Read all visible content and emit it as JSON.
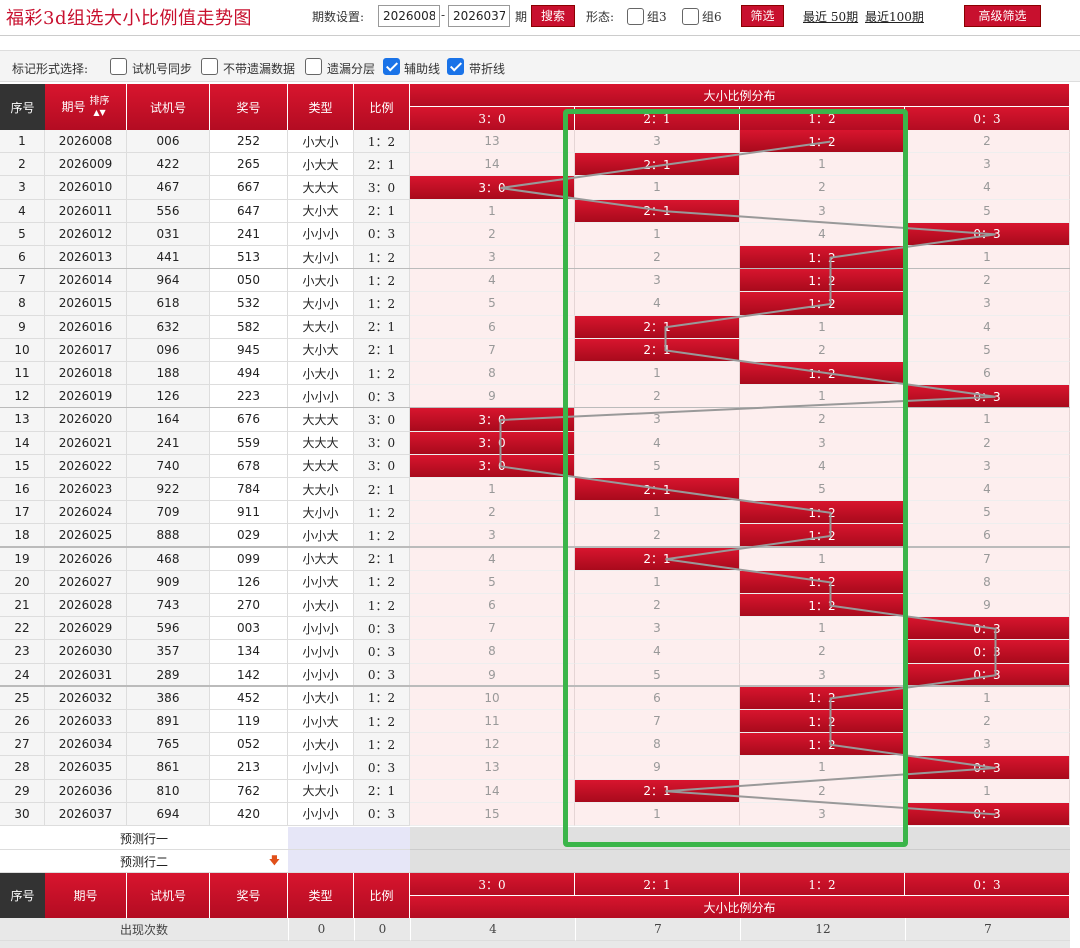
{
  "header": {
    "title": "福彩3d组选大小比例值走势图",
    "period_label": "期数设置:",
    "period_from": "2026008",
    "period_dash": "-",
    "period_to": "2026037",
    "period_unit": "期",
    "search_label": "搜索",
    "form_label": "形态:",
    "group3_label": "组3",
    "group6_label": "组6",
    "filter_label": "筛选",
    "recent50_label": "最近 50期",
    "recent100_label": "最近100期",
    "advanced_label": "高级筛选"
  },
  "options": {
    "label": "标记形式选择:",
    "items": [
      {
        "label": "试机号同步",
        "checked": false
      },
      {
        "label": "不带遗漏数据",
        "checked": false
      },
      {
        "label": "遗漏分层",
        "checked": false
      },
      {
        "label": "辅助线",
        "checked": true
      },
      {
        "label": "带折线",
        "checked": true
      }
    ]
  },
  "table": {
    "headers": {
      "seq": "序号",
      "period": "期号",
      "sort": "排序",
      "trial": "试机号",
      "award": "奖号",
      "type": "类型",
      "ratio": "比例",
      "dist": "大小比例分布"
    },
    "dist_cols": [
      "3：0",
      "2：1",
      "1：2",
      "0：3"
    ],
    "rows": [
      {
        "seq": "1",
        "period": "2026008",
        "trial": "006",
        "award": "252",
        "type": "小大小",
        "ratio": "1：2",
        "d": [
          "13",
          "3",
          "1：2",
          "2"
        ],
        "hit": 2
      },
      {
        "seq": "2",
        "period": "2026009",
        "trial": "422",
        "award": "265",
        "type": "小大大",
        "ratio": "2：1",
        "d": [
          "14",
          "2：1",
          "1",
          "3"
        ],
        "hit": 1
      },
      {
        "seq": "3",
        "period": "2026010",
        "trial": "467",
        "award": "667",
        "type": "大大大",
        "ratio": "3：0",
        "d": [
          "3：0",
          "1",
          "2",
          "4"
        ],
        "hit": 0
      },
      {
        "seq": "4",
        "period": "2026011",
        "trial": "556",
        "award": "647",
        "type": "大小大",
        "ratio": "2：1",
        "d": [
          "1",
          "2：1",
          "3",
          "5"
        ],
        "hit": 1
      },
      {
        "seq": "5",
        "period": "2026012",
        "trial": "031",
        "award": "241",
        "type": "小小小",
        "ratio": "0：3",
        "d": [
          "2",
          "1",
          "4",
          "0：3"
        ],
        "hit": 3
      },
      {
        "seq": "6",
        "period": "2026013",
        "trial": "441",
        "award": "513",
        "type": "大小小",
        "ratio": "1：2",
        "d": [
          "3",
          "2",
          "1：2",
          "1"
        ],
        "hit": 2
      },
      {
        "seq": "7",
        "period": "2026014",
        "trial": "964",
        "award": "050",
        "type": "小大小",
        "ratio": "1：2",
        "d": [
          "4",
          "3",
          "1：2",
          "2"
        ],
        "hit": 2
      },
      {
        "seq": "8",
        "period": "2026015",
        "trial": "618",
        "award": "532",
        "type": "大小小",
        "ratio": "1：2",
        "d": [
          "5",
          "4",
          "1：2",
          "3"
        ],
        "hit": 2
      },
      {
        "seq": "9",
        "period": "2026016",
        "trial": "632",
        "award": "582",
        "type": "大大小",
        "ratio": "2：1",
        "d": [
          "6",
          "2：1",
          "1",
          "4"
        ],
        "hit": 1
      },
      {
        "seq": "10",
        "period": "2026017",
        "trial": "096",
        "award": "945",
        "type": "大小大",
        "ratio": "2：1",
        "d": [
          "7",
          "2：1",
          "2",
          "5"
        ],
        "hit": 1
      },
      {
        "seq": "11",
        "period": "2026018",
        "trial": "188",
        "award": "494",
        "type": "小大小",
        "ratio": "1：2",
        "d": [
          "8",
          "1",
          "1：2",
          "6"
        ],
        "hit": 2
      },
      {
        "seq": "12",
        "period": "2026019",
        "trial": "126",
        "award": "223",
        "type": "小小小",
        "ratio": "0：3",
        "d": [
          "9",
          "2",
          "1",
          "0：3"
        ],
        "hit": 3
      },
      {
        "seq": "13",
        "period": "2026020",
        "trial": "164",
        "award": "676",
        "type": "大大大",
        "ratio": "3：0",
        "d": [
          "3：0",
          "3",
          "2",
          "1"
        ],
        "hit": 0
      },
      {
        "seq": "14",
        "period": "2026021",
        "trial": "241",
        "award": "559",
        "type": "大大大",
        "ratio": "3：0",
        "d": [
          "3：0",
          "4",
          "3",
          "2"
        ],
        "hit": 0
      },
      {
        "seq": "15",
        "period": "2026022",
        "trial": "740",
        "award": "678",
        "type": "大大大",
        "ratio": "3：0",
        "d": [
          "3：0",
          "5",
          "4",
          "3"
        ],
        "hit": 0
      },
      {
        "seq": "16",
        "period": "2026023",
        "trial": "922",
        "award": "784",
        "type": "大大小",
        "ratio": "2：1",
        "d": [
          "1",
          "2：1",
          "5",
          "4"
        ],
        "hit": 1
      },
      {
        "seq": "17",
        "period": "2026024",
        "trial": "709",
        "award": "911",
        "type": "大小小",
        "ratio": "1：2",
        "d": [
          "2",
          "1",
          "1：2",
          "5"
        ],
        "hit": 2
      },
      {
        "seq": "18",
        "period": "2026025",
        "trial": "888",
        "award": "029",
        "type": "小小大",
        "ratio": "1：2",
        "d": [
          "3",
          "2",
          "1：2",
          "6"
        ],
        "hit": 2
      },
      {
        "seq": "19",
        "period": "2026026",
        "trial": "468",
        "award": "099",
        "type": "小大大",
        "ratio": "2：1",
        "d": [
          "4",
          "2：1",
          "1",
          "7"
        ],
        "hit": 1
      },
      {
        "seq": "20",
        "period": "2026027",
        "trial": "909",
        "award": "126",
        "type": "小小大",
        "ratio": "1：2",
        "d": [
          "5",
          "1",
          "1：2",
          "8"
        ],
        "hit": 2
      },
      {
        "seq": "21",
        "period": "2026028",
        "trial": "743",
        "award": "270",
        "type": "小大小",
        "ratio": "1：2",
        "d": [
          "6",
          "2",
          "1：2",
          "9"
        ],
        "hit": 2
      },
      {
        "seq": "22",
        "period": "2026029",
        "trial": "596",
        "award": "003",
        "type": "小小小",
        "ratio": "0：3",
        "d": [
          "7",
          "3",
          "1",
          "0：3"
        ],
        "hit": 3
      },
      {
        "seq": "23",
        "period": "2026030",
        "trial": "357",
        "award": "134",
        "type": "小小小",
        "ratio": "0：3",
        "d": [
          "8",
          "4",
          "2",
          "0：3"
        ],
        "hit": 3
      },
      {
        "seq": "24",
        "period": "2026031",
        "trial": "289",
        "award": "142",
        "type": "小小小",
        "ratio": "0：3",
        "d": [
          "9",
          "5",
          "3",
          "0：3"
        ],
        "hit": 3
      },
      {
        "seq": "25",
        "period": "2026032",
        "trial": "386",
        "award": "452",
        "type": "小大小",
        "ratio": "1：2",
        "d": [
          "10",
          "6",
          "1：2",
          "1"
        ],
        "hit": 2
      },
      {
        "seq": "26",
        "period": "2026033",
        "trial": "891",
        "award": "119",
        "type": "小小大",
        "ratio": "1：2",
        "d": [
          "11",
          "7",
          "1：2",
          "2"
        ],
        "hit": 2
      },
      {
        "seq": "27",
        "period": "2026034",
        "trial": "765",
        "award": "052",
        "type": "小大小",
        "ratio": "1：2",
        "d": [
          "12",
          "8",
          "1：2",
          "3"
        ],
        "hit": 2
      },
      {
        "seq": "28",
        "period": "2026035",
        "trial": "861",
        "award": "213",
        "type": "小小小",
        "ratio": "0：3",
        "d": [
          "13",
          "9",
          "1",
          "0：3"
        ],
        "hit": 3
      },
      {
        "seq": "29",
        "period": "2026036",
        "trial": "810",
        "award": "762",
        "type": "大大小",
        "ratio": "2：1",
        "d": [
          "14",
          "2：1",
          "2",
          "1"
        ],
        "hit": 1
      },
      {
        "seq": "30",
        "period": "2026037",
        "trial": "694",
        "award": "420",
        "type": "小小小",
        "ratio": "0：3",
        "d": [
          "15",
          "1",
          "3",
          "0：3"
        ],
        "hit": 3
      }
    ],
    "predict1": "预测行一",
    "predict2": "预测行二",
    "stats": {
      "label": "出现次数",
      "type_val": "0",
      "ratio_val": "0",
      "values": [
        "4",
        "7",
        "12",
        "7"
      ]
    }
  },
  "colors": {
    "brand_red": "#c8102e",
    "highlight_green": "#3bb54a",
    "check_blue": "#1a73e8"
  }
}
